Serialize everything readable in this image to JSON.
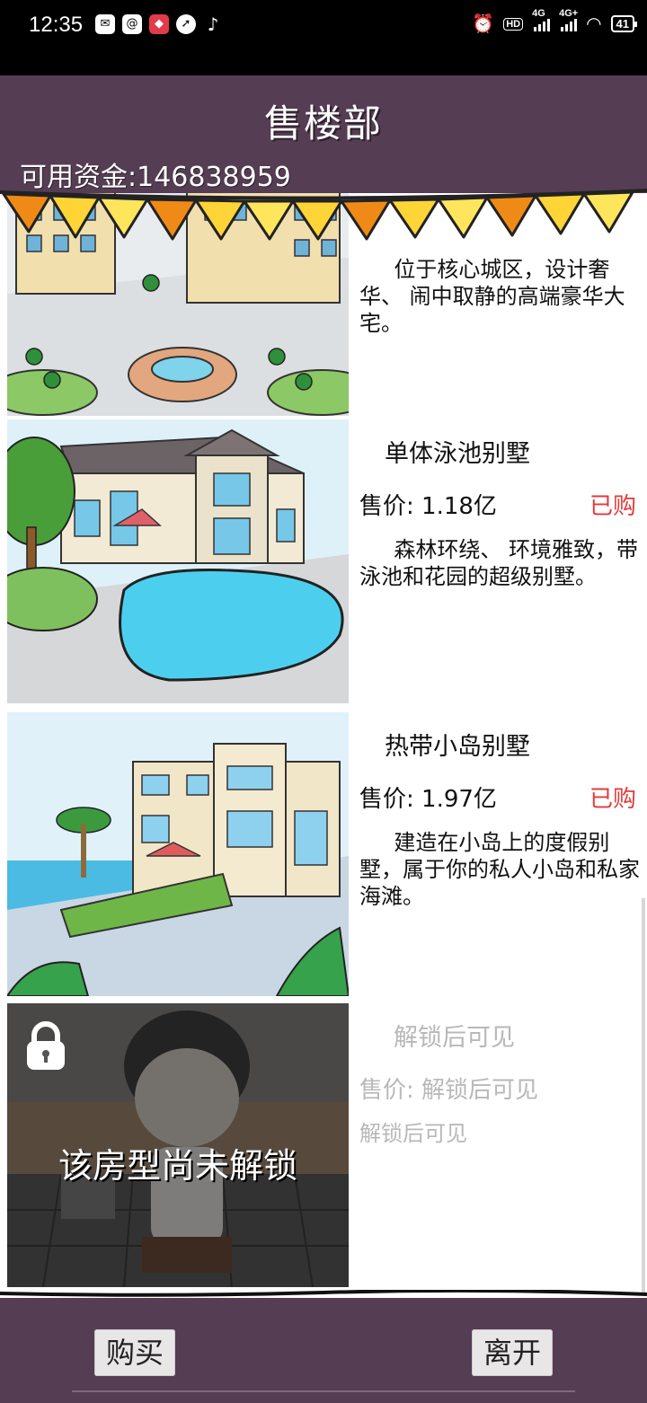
{
  "status_bar": {
    "time": "12:35",
    "left_icons": [
      "mail-icon",
      "at-icon",
      "app-icon",
      "compass-icon",
      "tiktok-icon"
    ],
    "hd_label": "HD",
    "network_1": "4G",
    "network_2": "4G+",
    "battery": "41"
  },
  "header": {
    "title": "售楼部",
    "funds": "可用资金:146838959"
  },
  "houses": [
    {
      "name": "",
      "price": "",
      "status": "",
      "desc": "位于核心城区，设计奢华、 闹中取静的高端豪华大宅。"
    },
    {
      "name": "单体泳池别墅",
      "price": "售价: 1.18亿",
      "status": "已购",
      "desc": "森林环绕、 环境雅致，带泳池和花园的超级别墅。"
    },
    {
      "name": "热带小岛别墅",
      "price": "售价: 1.97亿",
      "status": "已购",
      "desc": "建造在小岛上的度假别墅，属于你的私人小岛和私家海滩。"
    },
    {
      "name": "解锁后可见",
      "price": "售价: 解锁后可见",
      "status": "",
      "desc": "解锁后可见",
      "lock_label": "该房型尚未解锁"
    }
  ],
  "buttons": {
    "buy": "购买",
    "leave": "离开"
  },
  "colors": {
    "background": "#553d54",
    "bought": "#e23b3b",
    "locked_text": "#b8b8b8"
  }
}
